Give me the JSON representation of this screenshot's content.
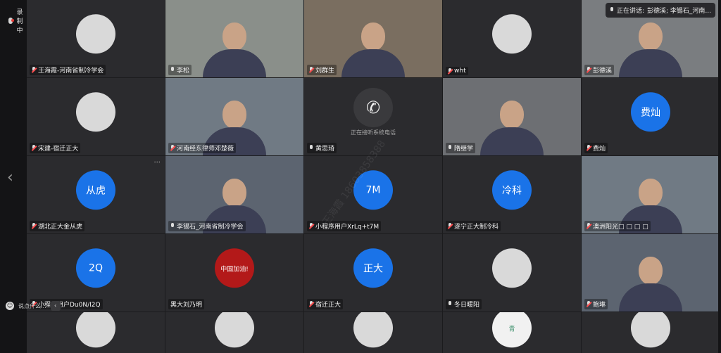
{
  "recording": {
    "label": "录制中"
  },
  "speaking": {
    "prefix": "正在讲话:",
    "names": "彭德溪; 李锡石_河南..."
  },
  "chat": {
    "placeholder": "说点什么..."
  },
  "watermark": "王海霞 18603858388",
  "participants": [
    {
      "name": "王海霞-河南省制冷学会",
      "muted": true,
      "kind": "img"
    },
    {
      "name": "李松",
      "muted": false,
      "kind": "photo"
    },
    {
      "name": "刘群生",
      "muted": true,
      "kind": "photo"
    },
    {
      "name": "wht",
      "muted": true,
      "kind": "img"
    },
    {
      "name": "彭德溪",
      "muted": true,
      "kind": "photo"
    },
    {
      "name": "宋建-宿迁正大",
      "muted": true,
      "kind": "img"
    },
    {
      "name": "河南经东律师邓楚薇",
      "muted": true,
      "kind": "photo"
    },
    {
      "name": "黄思琦",
      "muted": false,
      "kind": "phone",
      "phone_text": "正在接听系统电话"
    },
    {
      "name": "隋继学",
      "muted": false,
      "kind": "photo"
    },
    {
      "name": "费灿",
      "muted": true,
      "kind": "blue",
      "initials": "费灿"
    },
    {
      "name": "湖北正大金从虎",
      "muted": true,
      "kind": "blue",
      "initials": "从虎"
    },
    {
      "name": "李锡石_河南省制冷学会",
      "muted": false,
      "kind": "photo"
    },
    {
      "name": "小程序用户XrLq+t7M",
      "muted": true,
      "kind": "blue",
      "initials": "7M"
    },
    {
      "name": "遂宁正大制冷科",
      "muted": true,
      "kind": "blue",
      "initials": "冷科"
    },
    {
      "name": "澳洲阳光□ □ □ □",
      "muted": true,
      "kind": "photo"
    },
    {
      "name": "小程序用户Du0N/I2Q",
      "muted": true,
      "kind": "blue",
      "initials": "2Q"
    },
    {
      "name": "黑大刘乃明",
      "muted": null,
      "kind": "img",
      "img_text": "中国加油!"
    },
    {
      "name": "宿迁正大",
      "muted": true,
      "kind": "blue",
      "initials": "正大"
    },
    {
      "name": "冬日暖阳",
      "muted": false,
      "kind": "img"
    },
    {
      "name": "鲍琳",
      "muted": true,
      "kind": "photo"
    },
    {
      "name": "",
      "muted": null,
      "kind": "img"
    },
    {
      "name": "",
      "muted": null,
      "kind": "img"
    },
    {
      "name": "",
      "muted": null,
      "kind": "img"
    },
    {
      "name": "",
      "muted": null,
      "kind": "img",
      "img_text": "青"
    },
    {
      "name": "",
      "muted": null,
      "kind": "img"
    }
  ]
}
